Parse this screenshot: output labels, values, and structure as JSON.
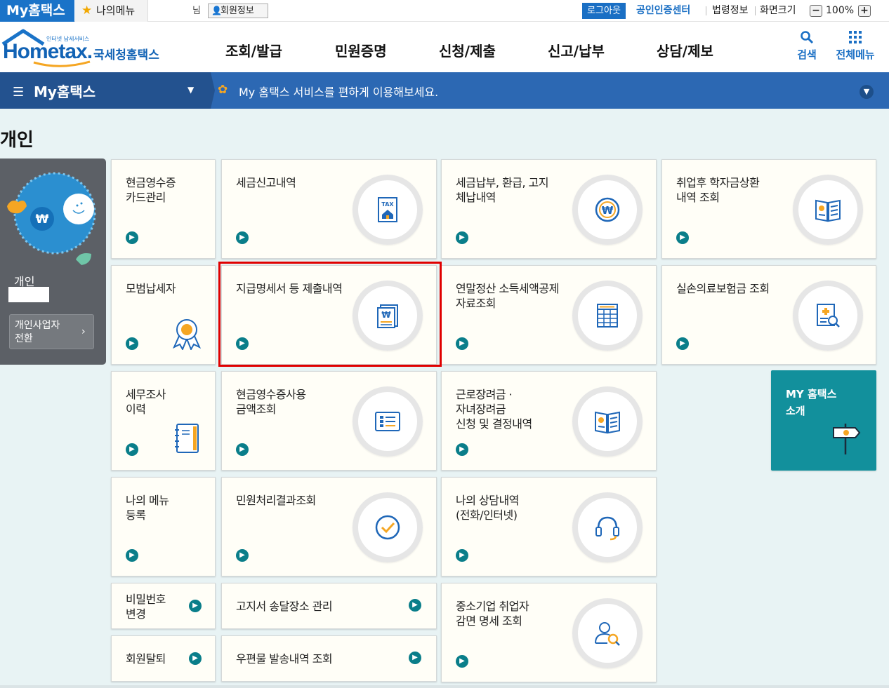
{
  "topbar": {
    "my_hometax_tab": "My홈택스",
    "my_menu": "나의메뉴",
    "user_suffix": "님",
    "member_info": "회원정보",
    "logout": "로그아웃",
    "cert_center": "공인인증센터",
    "law_info": "법령정보",
    "screen_size_label": "화면크기",
    "zoom_minus": "−",
    "zoom_value": "100%",
    "zoom_plus": "+"
  },
  "header": {
    "logo_tag": "인터넷 납세서비스",
    "logo_text": "Hometax.",
    "logo_kr": "국세청홈택스",
    "nav": [
      "조회/발급",
      "민원증명",
      "신청/제출",
      "신고/납부",
      "상담/제보"
    ],
    "search_label": "검색",
    "all_menu_label": "전체메뉴"
  },
  "mybar": {
    "title": "My홈택스",
    "message": "My 홈택스 서비스를 편하게 이용해보세요."
  },
  "main": {
    "page_title": "개인",
    "profile": {
      "user_label": "개인",
      "switch_line1": "개인사업자",
      "switch_line2": "전환"
    },
    "cards": [
      {
        "id": "cash-receipt-card",
        "lines": [
          "현금영수증",
          "카드관리"
        ]
      },
      {
        "id": "tax-return-history",
        "lines": [
          "세금신고내역"
        ],
        "icon": "tax-document-icon"
      },
      {
        "id": "tax-payment",
        "lines": [
          "세금납부, 환급, 고지",
          "체납내역"
        ],
        "icon": "won-coin-icon"
      },
      {
        "id": "student-loan",
        "lines": [
          "취업후 학자금상환",
          "내역 조회"
        ],
        "icon": "open-book-icon"
      },
      {
        "id": "model-taxpayer",
        "lines": [
          "모범납세자"
        ],
        "icon": "award-ribbon-icon"
      },
      {
        "id": "payment-statement",
        "lines": [
          "지급명세서 등 제출내역"
        ],
        "icon": "won-document-icon"
      },
      {
        "id": "year-end-settlement",
        "lines": [
          "연말정산 소득세액공제",
          "자료조회"
        ],
        "icon": "table-sheet-icon"
      },
      {
        "id": "medical-insurance",
        "lines": [
          "실손의료보험금 조회"
        ],
        "icon": "medical-search-icon"
      },
      {
        "id": "tax-audit",
        "lines": [
          "세무조사",
          "이력"
        ],
        "icon": "notebook-icon"
      },
      {
        "id": "cash-receipt-amount",
        "lines": [
          "현금영수증사용",
          "금액조회"
        ],
        "icon": "receipt-list-icon"
      },
      {
        "id": "earned-income-credit",
        "lines": [
          "근로장려금 ·",
          "자녀장려금",
          "신청 및 결정내역"
        ],
        "icon": "open-book-icon"
      },
      {
        "id": "my-menu-register",
        "lines": [
          "나의 메뉴",
          "등록"
        ]
      },
      {
        "id": "civil-result",
        "lines": [
          "민원처리결과조회"
        ],
        "icon": "check-circle-icon"
      },
      {
        "id": "consult-history",
        "lines": [
          "나의 상담내역",
          "(전화/인터넷)"
        ],
        "icon": "headset-icon"
      },
      {
        "id": "password-change",
        "lines": [
          "비밀번호",
          "변경"
        ]
      },
      {
        "id": "bill-address",
        "lines": [
          "고지서 송달장소 관리"
        ]
      },
      {
        "id": "sme-employee",
        "lines": [
          "중소기업 취업자",
          "감면 명세 조회"
        ],
        "icon": "person-search-icon"
      },
      {
        "id": "withdraw",
        "lines": [
          "회원탈퇴"
        ]
      },
      {
        "id": "mail-history",
        "lines": [
          "우편물 발송내역 조회"
        ]
      }
    ],
    "intro": {
      "line1": "MY 홈택스",
      "line2": "소개"
    }
  },
  "colors": {
    "brand_blue": "#1a73c8",
    "bar_blue": "#2c68b3",
    "teal": "#12909c",
    "go_button": "#0a7e8a",
    "highlight": "#e00000",
    "icon_blue": "#1f67b8",
    "icon_orange": "#f5a623"
  }
}
